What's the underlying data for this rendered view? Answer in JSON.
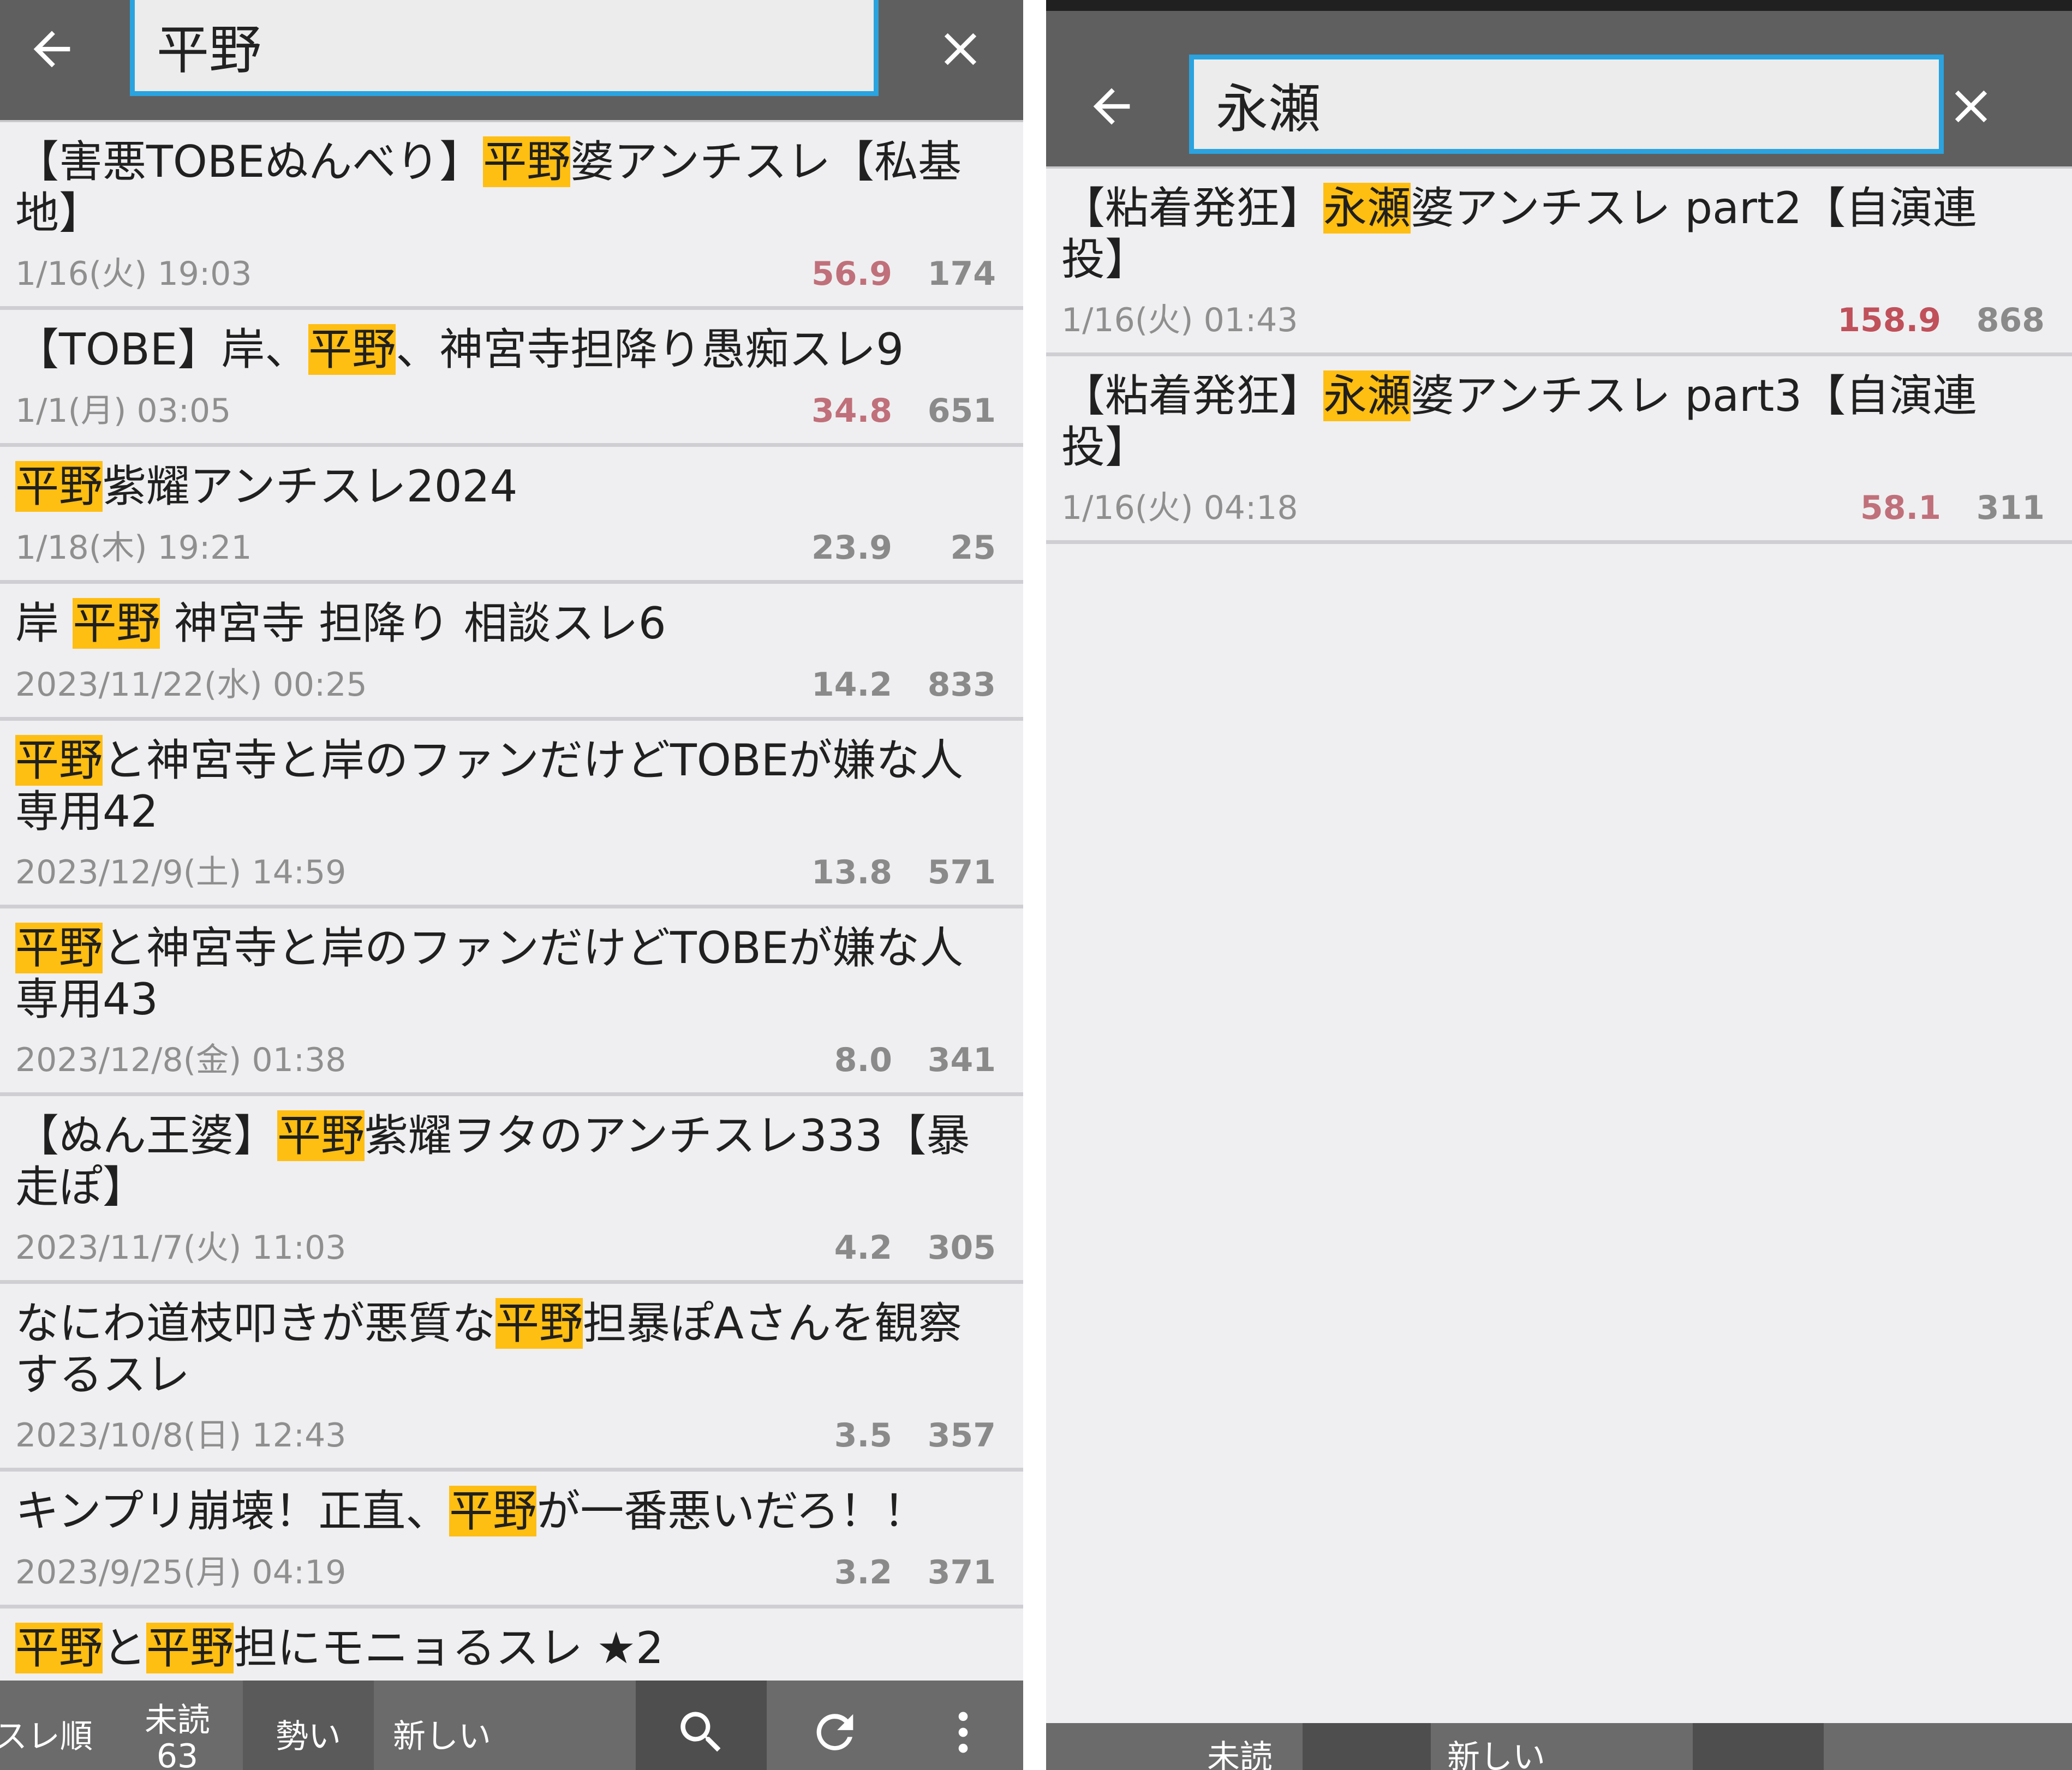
{
  "left": {
    "search_query": "平野",
    "threads": [
      {
        "segments": [
          [
            "【害悪TOBEぬんべり】",
            false
          ],
          [
            "平野",
            true
          ],
          [
            "婆アンチスレ【私基地】",
            false
          ]
        ],
        "date": "1/16(火) 19:03",
        "speed": "56.9",
        "count": "174",
        "speed_color": "#c0707a"
      },
      {
        "segments": [
          [
            "【TOBE】岸、",
            false
          ],
          [
            "平野",
            true
          ],
          [
            "、神宮寺担降り愚痴スレ9",
            false
          ]
        ],
        "date": "1/1(月) 03:05",
        "speed": "34.8",
        "count": "651",
        "speed_color": "#c0707a"
      },
      {
        "segments": [
          [
            "平野",
            true
          ],
          [
            "紫耀アンチスレ2024",
            false
          ]
        ],
        "date": "1/18(木) 19:21",
        "speed": "23.9",
        "count": "25",
        "speed_color": "#8a8a8a"
      },
      {
        "segments": [
          [
            "岸 ",
            false
          ],
          [
            "平野",
            true
          ],
          [
            " 神宮寺 担降り 相談スレ6",
            false
          ]
        ],
        "date": "2023/11/22(水) 00:25",
        "speed": "14.2",
        "count": "833",
        "speed_color": "#8a8a8a"
      },
      {
        "segments": [
          [
            "平野",
            true
          ],
          [
            "と神宮寺と岸のファンだけどTOBEが嫌な人専用42",
            false
          ]
        ],
        "date": "2023/12/9(土) 14:59",
        "speed": "13.8",
        "count": "571",
        "speed_color": "#8a8a8a"
      },
      {
        "segments": [
          [
            "平野",
            true
          ],
          [
            "と神宮寺と岸のファンだけどTOBEが嫌な人専用43",
            false
          ]
        ],
        "date": "2023/12/8(金) 01:38",
        "speed": "8.0",
        "count": "341",
        "speed_color": "#8a8a8a"
      },
      {
        "segments": [
          [
            "【ぬん王婆】",
            false
          ],
          [
            "平野",
            true
          ],
          [
            "紫耀ヲタのアンチスレ333【暴走ぽ】",
            false
          ]
        ],
        "date": "2023/11/7(火) 11:03",
        "speed": "4.2",
        "count": "305",
        "speed_color": "#8a8a8a"
      },
      {
        "segments": [
          [
            "なにわ道枝叩きが悪質な",
            false
          ],
          [
            "平野",
            true
          ],
          [
            "担暴ぽAさんを観察するスレ",
            false
          ]
        ],
        "date": "2023/10/8(日) 12:43",
        "speed": "3.5",
        "count": "357",
        "speed_color": "#8a8a8a"
      },
      {
        "segments": [
          [
            "キンプリ崩壊！正直、",
            false
          ],
          [
            "平野",
            true
          ],
          [
            "が一番悪いだろ！！",
            false
          ]
        ],
        "date": "2023/9/25(月) 04:19",
        "speed": "3.2",
        "count": "371",
        "speed_color": "#8a8a8a"
      },
      {
        "segments": [
          [
            "平野",
            true
          ],
          [
            "と",
            false
          ],
          [
            "平野",
            true
          ],
          [
            "担にモニョるスレ ★2",
            false
          ]
        ],
        "date": "",
        "speed": "",
        "count": "",
        "speed_color": "#8a8a8a"
      }
    ],
    "toolbar": {
      "sort_order": "スレ順",
      "unread": "未読",
      "unread_count": "63",
      "momentum": "勢い",
      "newest": "新しい"
    }
  },
  "right": {
    "search_query": "永瀬",
    "threads": [
      {
        "segments": [
          [
            "【粘着発狂】",
            false
          ],
          [
            "永瀬",
            true
          ],
          [
            "婆アンチスレ part2【自演連投】",
            false
          ]
        ],
        "date": "1/16(火) 01:43",
        "speed": "158.9",
        "count": "868",
        "speed_color": "#c0505a"
      },
      {
        "segments": [
          [
            "【粘着発狂】",
            false
          ],
          [
            "永瀬",
            true
          ],
          [
            "婆アンチスレ part3【自演連投】",
            false
          ]
        ],
        "date": "1/16(火) 04:18",
        "speed": "58.1",
        "count": "311",
        "speed_color": "#c0707a"
      }
    ],
    "toolbar": {
      "unread": "未読",
      "newest": "新しい"
    }
  },
  "icons": {
    "back": "arrow-left-icon",
    "close": "close-icon",
    "search": "search-icon",
    "refresh": "refresh-icon",
    "menu": "more-vertical-icon"
  },
  "colors": {
    "highlight": "#ffbe12",
    "accent": "#2aa3df",
    "toolbar": "#5f5f5f"
  }
}
